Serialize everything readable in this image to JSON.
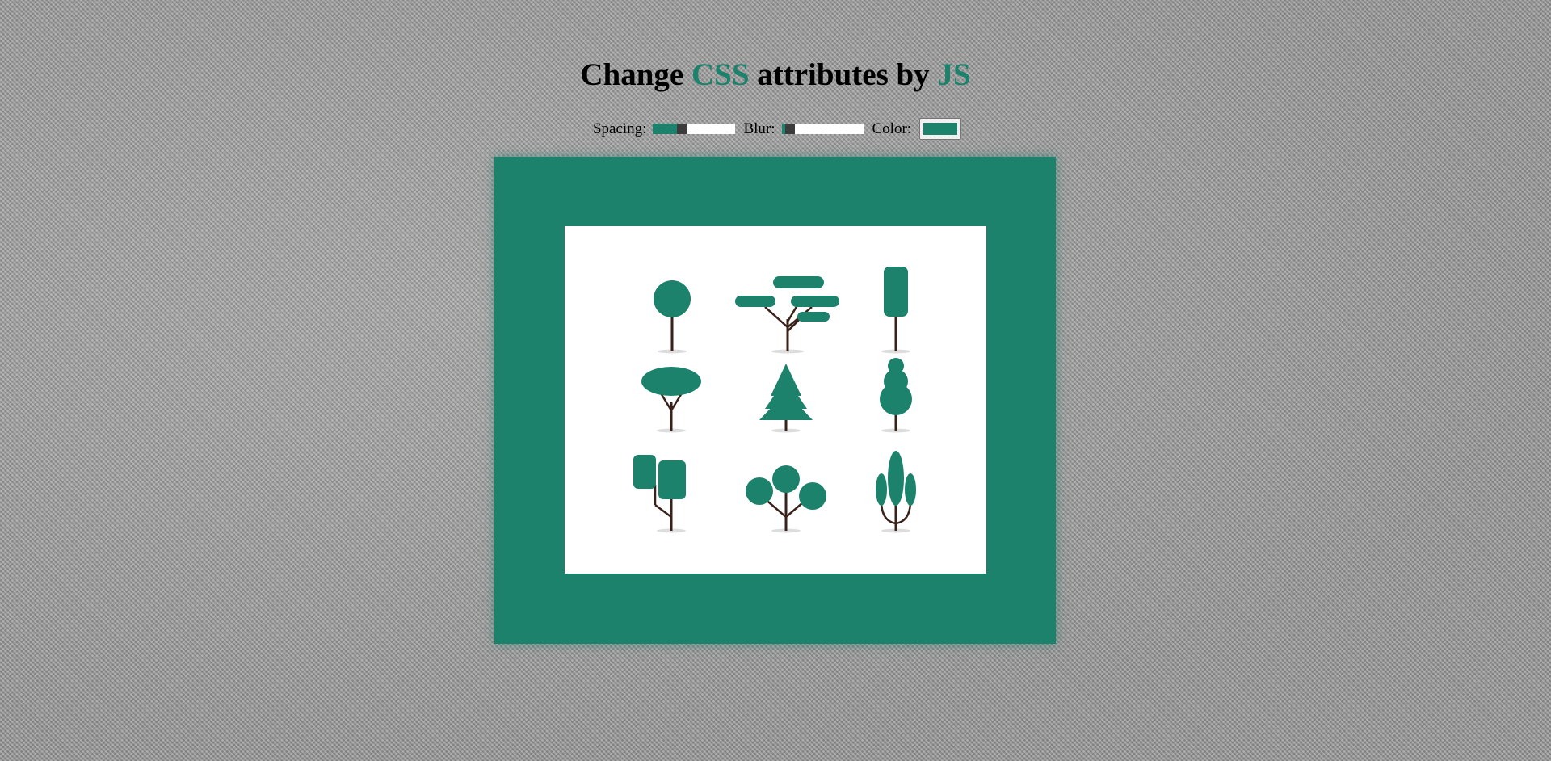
{
  "header": {
    "title_part1": "Change ",
    "title_highlight1": "CSS",
    "title_part2": " attributes by ",
    "title_highlight2": "JS"
  },
  "controls": {
    "spacing_label": "Spacing:",
    "spacing_value_fraction": 0.35,
    "blur_label": "Blur:",
    "blur_value_fraction": 0.1,
    "color_label": "Color:",
    "color_value": "#1d826c"
  },
  "colors": {
    "accent": "#1d826c",
    "trunk": "#3a221a",
    "shadow": "#dddddd",
    "image_background": "#ffffff"
  },
  "image": {
    "description_icons": [
      "round-tree-icon",
      "acacia-tree-icon",
      "tall-rounded-tree-icon",
      "umbrella-tree-icon",
      "pine-tree-icon",
      "stacked-tree-icon",
      "twin-square-tree-icon",
      "three-ball-tree-icon",
      "cypress-tree-icon"
    ]
  }
}
